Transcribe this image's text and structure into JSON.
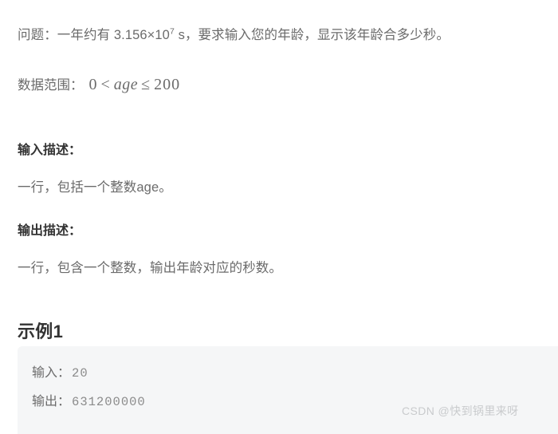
{
  "problem": {
    "prefix": "问题：一年约有 3.156×10",
    "exponent": "7",
    "suffix": " s，要求输入您的年龄，显示该年龄合多少秒。"
  },
  "data_range": {
    "label": "数据范围：",
    "math": {
      "lower": "0",
      "op1": "<",
      "variable": "age",
      "op2": "≤",
      "upper": "200"
    }
  },
  "input_section": {
    "heading": "输入描述：",
    "body": "一行，包括一个整数age。"
  },
  "output_section": {
    "heading": "输出描述：",
    "body": "一行，包含一个整数，输出年龄对应的秒数。"
  },
  "example": {
    "title": "示例1",
    "input_label": "输入：",
    "input_value": "20",
    "output_label": "输出：",
    "output_value": "631200000"
  },
  "watermark": {
    "text": "CSDN @快到锅里来呀"
  },
  "colors": {
    "page_background": "#ffffff",
    "body_text": "#6b6b6b",
    "heading_text": "#333333",
    "code_block_background": "#f5f6f7",
    "code_value_text": "#8b8b8b",
    "watermark_text": "#c9cbcd"
  }
}
